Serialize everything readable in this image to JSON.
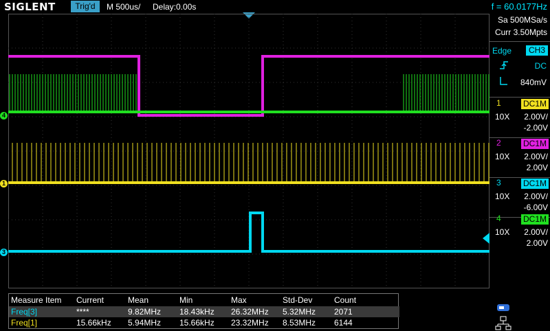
{
  "header": {
    "brand": "SIGLENT",
    "trigger_status": "Trig'd",
    "timebase": "M 500us/",
    "delay": "Delay:0.00s",
    "frequency": "f = 60.0177Hz"
  },
  "acquisition": {
    "sample_rate": "Sa 500MSa/s",
    "memory": "Curr 3.50Mpts"
  },
  "trigger": {
    "type": "Edge",
    "source": "CH3",
    "coupling": "DC",
    "level": "840mV"
  },
  "channels": [
    {
      "num": "1",
      "coupling": "DC1M",
      "probe": "10X",
      "scale": "2.00V/",
      "offset": "-2.00V",
      "color": "#f0e020"
    },
    {
      "num": "2",
      "coupling": "DC1M",
      "probe": "10X",
      "scale": "2.00V/",
      "offset": "2.00V",
      "color": "#e020e0"
    },
    {
      "num": "3",
      "coupling": "DC1M",
      "probe": "10X",
      "scale": "2.00V/",
      "offset": "-6.00V",
      "color": "#00d8f0"
    },
    {
      "num": "4",
      "coupling": "DC1M",
      "probe": "10X",
      "scale": "2.00V/",
      "offset": "2.00V",
      "color": "#20e020"
    }
  ],
  "markers": [
    {
      "label": "4"
    },
    {
      "label": "1"
    },
    {
      "label": "3"
    }
  ],
  "measure": {
    "headers": [
      "Measure Item",
      "Current",
      "Mean",
      "Min",
      "Max",
      "Std-Dev",
      "Count"
    ],
    "rows": [
      [
        "Freq[3]",
        "****",
        "9.82MHz",
        "18.43kHz",
        "26.32MHz",
        "5.32MHz",
        "2071"
      ],
      [
        "Freq[1]",
        "15.66kHz",
        "5.94MHz",
        "15.66kHz",
        "23.32MHz",
        "8.53MHz",
        "6144"
      ]
    ]
  }
}
